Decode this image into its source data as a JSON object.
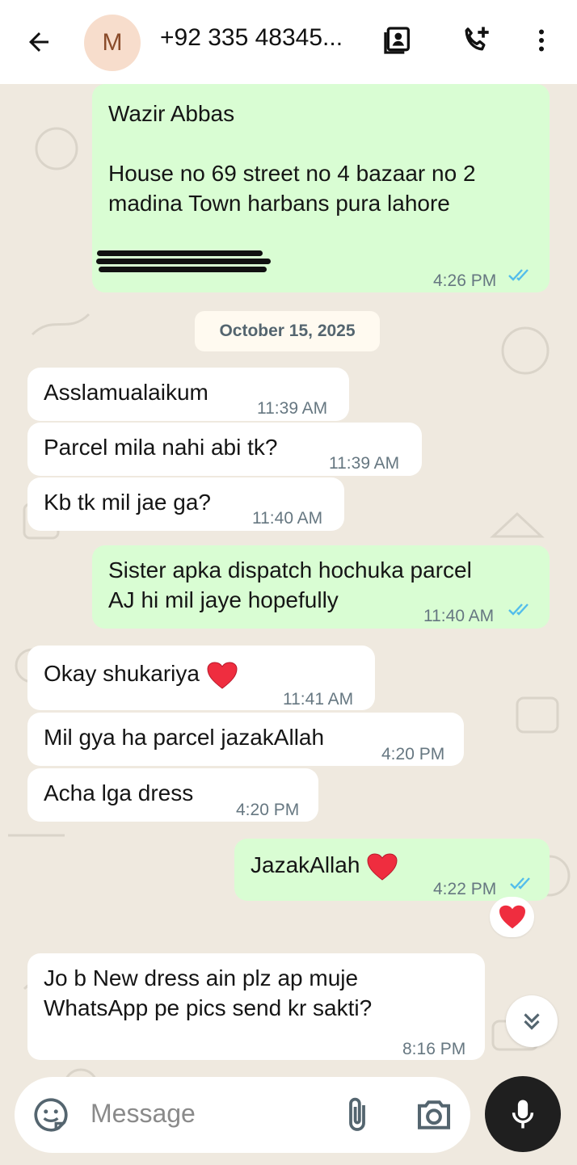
{
  "header": {
    "back_icon": "arrow-left-icon",
    "avatar_initial": "M",
    "contact_name": "+92 335 48345...",
    "contact_card_icon": "contact-card-icon",
    "add_call_icon": "add-call-icon",
    "more_icon": "more-vertical-icon"
  },
  "messages": [
    {
      "direction": "out",
      "lines": [
        "Wazir Abbas",
        "",
        "House no 69 street no 4 bazaar no 2",
        "madina Town harbans pura lahore",
        "",
        "redacted phone number"
      ],
      "time": "4:26 PM",
      "read": true
    },
    {
      "type": "date",
      "label": "October 15, 2025"
    },
    {
      "direction": "in",
      "text": "Asslamualaikum",
      "time": "11:39 AM"
    },
    {
      "direction": "in",
      "text": "Parcel mila nahi abi tk?",
      "time": "11:39 AM"
    },
    {
      "direction": "in",
      "text": "Kb tk mil jae ga?",
      "time": "11:40 AM"
    },
    {
      "direction": "out",
      "text": "Sister apka dispatch hochuka parcel",
      "text2": "AJ hi mil jaye hopefully",
      "time": "11:40 AM",
      "read": true
    },
    {
      "direction": "in",
      "text": "Okay shukariya",
      "time": "11:41 AM",
      "emoji": "heart"
    },
    {
      "direction": "in",
      "text": "Mil gya ha parcel jazakAllah",
      "time": "4:20 PM"
    },
    {
      "direction": "in",
      "text": "Acha lga dress",
      "time": "4:20 PM"
    },
    {
      "direction": "out",
      "text": "JazakAllah",
      "time": "4:22 PM",
      "read": true,
      "emoji": "heart",
      "reaction": "heart"
    },
    {
      "direction": "in",
      "text": "Jo b New dress ain plz ap muje",
      "text2": "WhatsApp pe pics send kr sakti?",
      "time": "8:16 PM"
    }
  ],
  "composer": {
    "placeholder": "Message",
    "sticker_icon": "sticker-icon",
    "attach_icon": "paperclip-icon",
    "camera_icon": "camera-icon",
    "mic_icon": "microphone-icon",
    "scroll_down_icon": "double-chevron-down-icon"
  },
  "colors": {
    "incoming_bubble": "#ffffff",
    "outgoing_bubble": "#d9fdd3",
    "read_ticks": "#53bdeb",
    "chat_background": "#efe9df"
  }
}
